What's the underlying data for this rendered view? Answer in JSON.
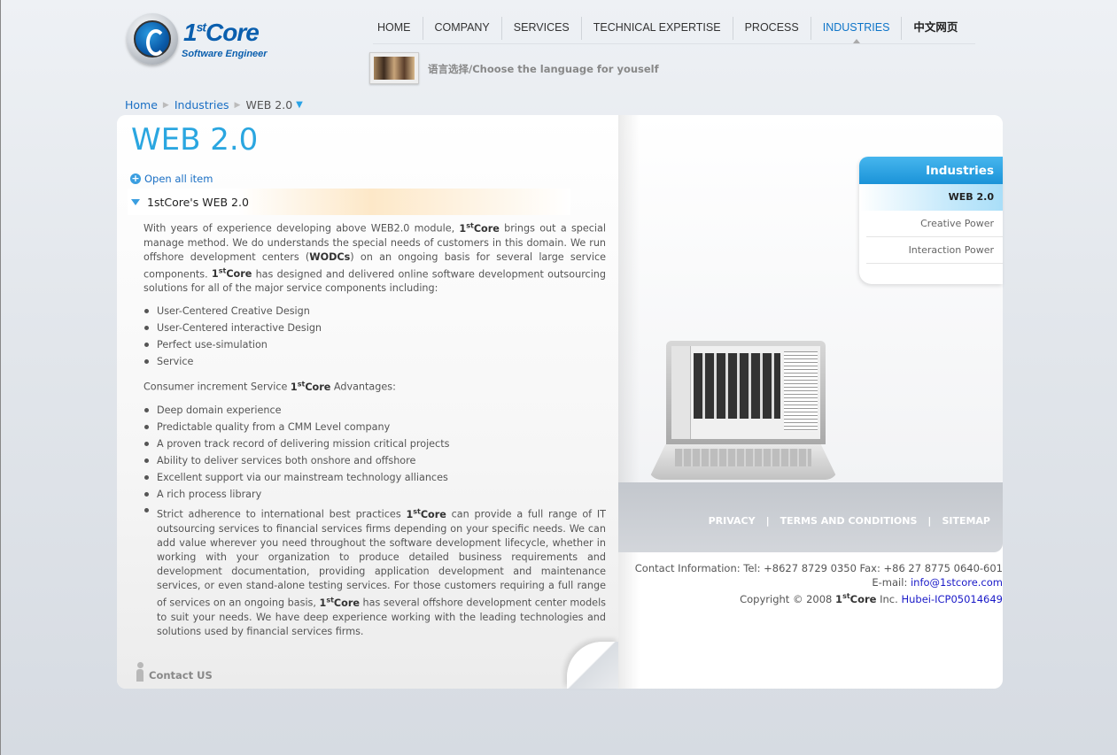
{
  "logo": {
    "brand": "1",
    "brand_sup": "st",
    "brand_rest": "Core",
    "tagline": "Software Engineer"
  },
  "nav": {
    "items": [
      {
        "label": "HOME"
      },
      {
        "label": "COMPANY"
      },
      {
        "label": "SERVICES"
      },
      {
        "label": "TECHNICAL EXPERTISE"
      },
      {
        "label": "PROCESS"
      },
      {
        "label": "INDUSTRIES",
        "active": true
      },
      {
        "label": "中文网页"
      }
    ]
  },
  "language": {
    "text": "语言选择/Choose the language for youself"
  },
  "breadcrumb": {
    "home": "Home",
    "industries": "Industries",
    "current": "WEB 2.0"
  },
  "main": {
    "title": "WEB 2.0",
    "open_all": "Open all item",
    "section_title": "1stCore's WEB 2.0",
    "para1_a": "With years of experience developing above WEB2.0 module,",
    "para1_b": "brings out a special manage method. We do understands the special needs of customers in this domain. We run offshore development centers (",
    "para1_wodc": "WODCs",
    "para1_c": ") on an ongoing basis for several large service components.",
    "para1_d": "has designed and delivered online software development outsourcing solutions for all of the major service components including:",
    "list1": [
      "User-Centered Creative Design",
      "User-Centered interactive Design",
      "Perfect use-simulation",
      "Service"
    ],
    "para2_a": "Consumer increment Service",
    "para2_b": "Advantages:",
    "list2": [
      "Deep domain experience",
      "Predictable quality from a CMM Level company",
      "A proven track record of delivering mission critical projects",
      "Ability to deliver services both onshore and offshore",
      "Excellent support via our mainstream technology alliances",
      "A rich process library"
    ],
    "long_item_a": "Strict adherence to international best practices",
    "long_item_b": "can provide a full range of IT outsourcing services to financial services firms depending on your specific needs. We can add value wherever you need throughout the software development lifecycle, whether in working with your organization to produce detailed business requirements and development documentation, providing application development and maintenance services, or even stand-alone testing services. For those customers requiring a full range of services on an ongoing basis,",
    "long_item_c": "has several offshore development center models to suit your needs. We have deep experience working with the leading technologies and solutions used by financial services firms.",
    "brand_num": "1",
    "brand_sup": "st",
    "brand_word": "Core",
    "contact_us": "Contact US"
  },
  "sidebar": {
    "header": "Industries",
    "items": [
      {
        "label": "WEB 2.0",
        "active": true
      },
      {
        "label": "Creative Power"
      },
      {
        "label": "Interaction Power"
      }
    ]
  },
  "footer": {
    "links": [
      "PRIVACY",
      "TERMS AND CONDITIONS",
      "SITEMAP"
    ],
    "separator": "|",
    "contact_line": "Contact Information: Tel: +8627 8729 0350 Fax: +86 27 8775 0640-601",
    "email_label": "E-mail:",
    "email": "info@1stcore.com",
    "copyright_a": "Copyright © 2008",
    "copyright_b": "Inc.",
    "icp": "Hubei-ICP05014649"
  },
  "colors": {
    "accent": "#2aa6e0",
    "link": "#1a6fc4",
    "nav_active": "#0d74c8"
  }
}
